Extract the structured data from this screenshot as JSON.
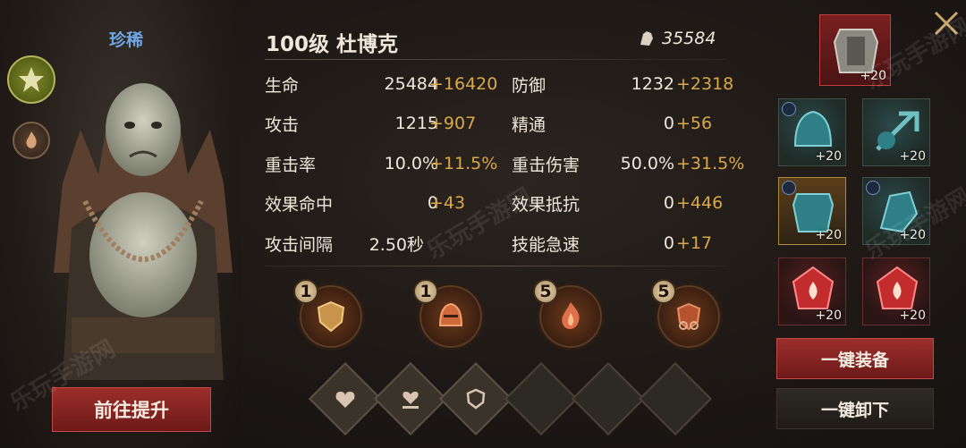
{
  "hero": {
    "rarity": "珍稀",
    "title": "100级 杜博克",
    "power": "35584",
    "upgrade_button": "前往提升"
  },
  "stats": [
    {
      "label": "生命",
      "base": "25484",
      "bonus": "+16420"
    },
    {
      "label": "防御",
      "base": "1232",
      "bonus": "+2318"
    },
    {
      "label": "攻击",
      "base": "1215",
      "bonus": "+907"
    },
    {
      "label": "精通",
      "base": "0",
      "bonus": "+56"
    },
    {
      "label": "重击率",
      "base": "10.0%",
      "bonus": "+11.5%"
    },
    {
      "label": "重击伤害",
      "base": "50.0%",
      "bonus": "+31.5%"
    },
    {
      "label": "效果命中",
      "base": "0",
      "bonus": "+43"
    },
    {
      "label": "效果抵抗",
      "base": "0",
      "bonus": "+446"
    },
    {
      "label": "攻击间隔",
      "base": "2.50秒",
      "bonus": ""
    },
    {
      "label": "技能急速",
      "base": "0",
      "bonus": "+17"
    }
  ],
  "skills": [
    {
      "level": "1",
      "icon": "shield-icon"
    },
    {
      "level": "1",
      "icon": "helmet-icon"
    },
    {
      "level": "5",
      "icon": "flame-icon"
    },
    {
      "level": "5",
      "icon": "chain-shield-icon"
    }
  ],
  "runes": [
    {
      "icon": "heart-icon",
      "filled": true
    },
    {
      "icon": "heart-hand-icon",
      "filled": true
    },
    {
      "icon": "shield-icon",
      "filled": true
    },
    {
      "icon": "",
      "filled": false
    },
    {
      "icon": "",
      "filled": false
    },
    {
      "icon": "",
      "filled": false
    }
  ],
  "equipment": {
    "armor": {
      "icon": "chest-armor-icon",
      "level": "+20"
    },
    "items": [
      {
        "icon": "helmet-icon",
        "level": "+20"
      },
      {
        "icon": "weapon-icon",
        "level": "+20"
      },
      {
        "icon": "chest-icon",
        "level": "+20"
      },
      {
        "icon": "gauntlet-icon",
        "level": "+20"
      },
      {
        "icon": "fire-gem-icon",
        "level": "+20"
      },
      {
        "icon": "fire-gem-icon",
        "level": "+20"
      }
    ]
  },
  "buttons": {
    "equip_all": "一键装备",
    "unequip_all": "一键卸下"
  },
  "watermark": "乐玩手游网",
  "colors": {
    "bonus": "#d9a84a",
    "rarity": "#6fa6e6",
    "accent_red": "#9c2e2b"
  }
}
